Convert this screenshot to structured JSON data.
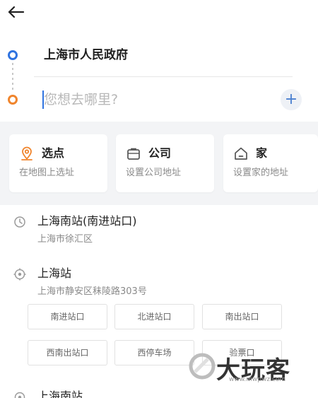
{
  "nav": {
    "back_icon": "arrow-left-icon"
  },
  "route": {
    "start": "上海市人民政府",
    "destination_placeholder": "您想去哪里?",
    "destination_value": "",
    "add_icon": "plus-icon",
    "start_color": "#2f73e0",
    "end_color": "#f0852d"
  },
  "shortcuts": [
    {
      "title": "选点",
      "subtitle": "在地图上选址",
      "icon": "location-pin-icon",
      "icon_color": "#f0852d"
    },
    {
      "title": "公司",
      "subtitle": "设置公司地址",
      "icon": "briefcase-icon",
      "icon_color": "#555555"
    },
    {
      "title": "家",
      "subtitle": "设置家的地址",
      "icon": "home-icon",
      "icon_color": "#555555"
    }
  ],
  "history": [
    {
      "title": "上海南站(南进站口)",
      "subtitle": "上海市徐汇区",
      "icon": "clock-icon"
    },
    {
      "title": "上海站",
      "subtitle": "上海市静安区秣陵路303号",
      "icon": "location-target-icon"
    }
  ],
  "exits": [
    "南进站口",
    "北进站口",
    "南出站口",
    "西南出站口",
    "西停车场",
    "验票口"
  ],
  "last_item": {
    "title": "上海南站",
    "icon": "location-target-icon"
  },
  "watermark": {
    "text": "大玩客",
    "url": "www.mwpwz.com"
  }
}
